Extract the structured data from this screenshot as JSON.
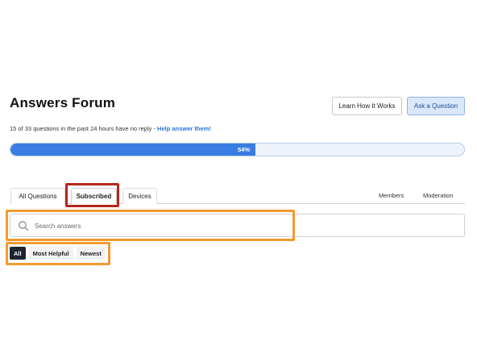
{
  "header": {
    "title": "Answers Forum",
    "learn_label": "Learn How It Works",
    "ask_label": "Ask a Question"
  },
  "status": {
    "prefix": "15 of 33 questions in the past 24 hours have no reply - ",
    "link": "Help answer them!"
  },
  "progress": {
    "value": 0.54,
    "label": "54%"
  },
  "tabs": {
    "all": "All Questions",
    "subscribed": "Subscribed",
    "devices": "Devices",
    "members": "Members",
    "moderation": "Moderation"
  },
  "search": {
    "placeholder": "Search answers"
  },
  "filters": {
    "all": "All",
    "most_helpful": "Most Helpful",
    "newest": "Newest"
  },
  "colors": {
    "accent": "#3a7de0",
    "highlight_red": "#b3271b",
    "highlight_orange": "#f29a2e"
  }
}
